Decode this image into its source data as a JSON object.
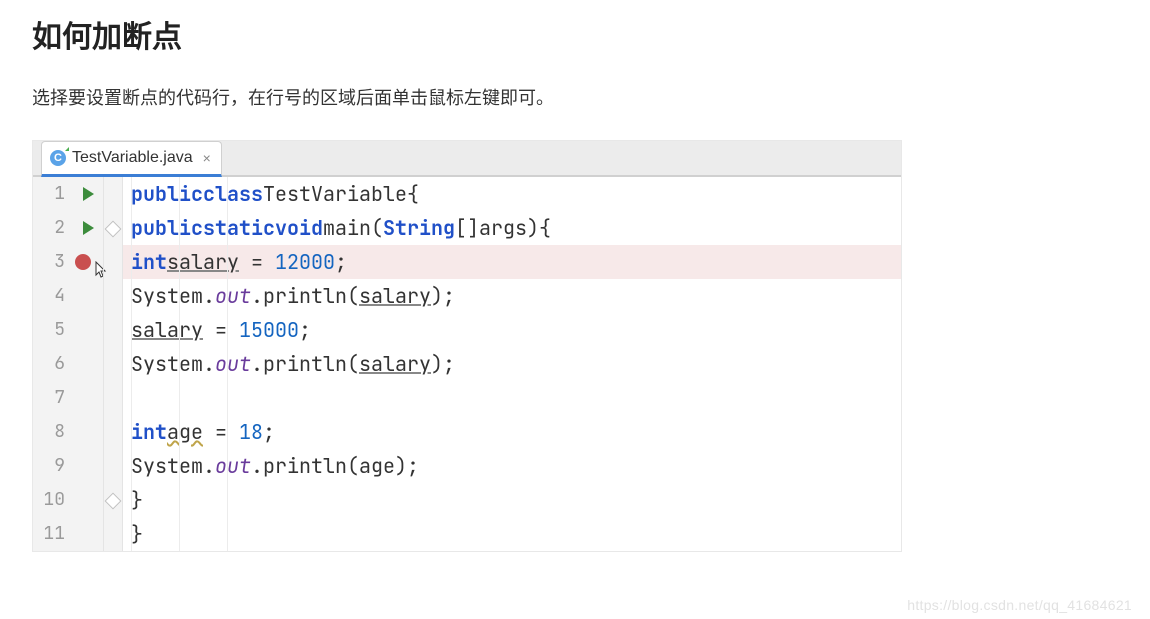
{
  "heading": "如何加断点",
  "intro": "选择要设置断点的代码行，在行号的区域后面单击鼠标左键即可。",
  "watermark": "https://blog.csdn.net/qq_41684621",
  "tab": {
    "file_name": "TestVariable.java",
    "icon_letter": "C",
    "close_glyph": "×"
  },
  "editor": {
    "line_numbers": [
      "1",
      "2",
      "3",
      "4",
      "5",
      "6",
      "7",
      "8",
      "9",
      "10",
      "11"
    ],
    "run_markers": [
      true,
      true,
      false,
      false,
      false,
      false,
      false,
      false,
      false,
      false,
      false
    ],
    "breakpoint_line_index": 2,
    "fold_top_index": 1,
    "fold_bottom_index": 9,
    "code": {
      "l1": {
        "kw1": "public",
        "kw2": "class",
        "cls": "TestVariable",
        "brace": "{"
      },
      "l2": {
        "kw1": "public",
        "kw2": "static",
        "kw3": "void",
        "name": "main",
        "lp": "(",
        "type": "String",
        "arr": "[]",
        "arg": "args",
        "rp": ")",
        "brace": "{"
      },
      "l3": {
        "type": "int",
        "var": "salary",
        "eq": " = ",
        "num": "12000",
        "semi": ";"
      },
      "l4": {
        "obj": "System",
        "dot1": ".",
        "field": "out",
        "dot2": ".",
        "call": "println",
        "lp": "(",
        "arg": "salary",
        "rp": ")",
        "semi": ";"
      },
      "l5": {
        "var": "salary",
        "eq": " = ",
        "num": "15000",
        "semi": ";"
      },
      "l6": {
        "obj": "System",
        "dot1": ".",
        "field": "out",
        "dot2": ".",
        "call": "println",
        "lp": "(",
        "arg": "salary",
        "rp": ")",
        "semi": ";"
      },
      "l7": {
        "blank": ""
      },
      "l8": {
        "type": "int",
        "var": "age",
        "eq": " = ",
        "num": "18",
        "semi": ";"
      },
      "l9": {
        "obj": "System",
        "dot1": ".",
        "field": "out",
        "dot2": ".",
        "call": "println",
        "lp": "(",
        "arg": "age",
        "rp": ")",
        "semi": ";"
      },
      "l10": {
        "brace": "}"
      },
      "l11": {
        "brace": "}"
      }
    }
  }
}
